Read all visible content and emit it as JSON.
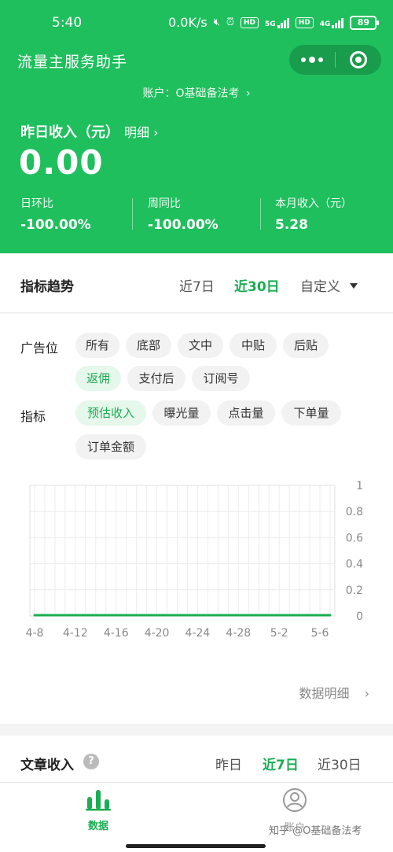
{
  "status_bar": {
    "time": "5:40",
    "net_speed": "0.0K/s",
    "hd1": "HD",
    "sig1": "5G",
    "hd2": "HD",
    "sig2": "4G",
    "battery": "89"
  },
  "header": {
    "app_title": "流量主服务助手",
    "account_label": "账户：O基础备法考",
    "account_chevron": "›",
    "yesterday_label": "昨日收入（元）",
    "detail_link": "明细 ›",
    "big_value": "0.00",
    "stats": [
      {
        "label": "日环比",
        "value": "-100.00%"
      },
      {
        "label": "周同比",
        "value": "-100.00%"
      },
      {
        "label": "本月收入（元）",
        "value": "5.28"
      }
    ]
  },
  "trend": {
    "title": "指标趋势",
    "range_tabs": [
      "近7日",
      "近30日",
      "自定义"
    ],
    "active_range": "近30日",
    "ad_position_label": "广告位",
    "ad_positions": [
      "所有",
      "底部",
      "文中",
      "中贴",
      "后贴",
      "返佣",
      "支付后",
      "订阅号"
    ],
    "metric_label": "指标",
    "metrics": [
      "预估收入",
      "曝光量",
      "点击量",
      "下单量",
      "订单金额"
    ],
    "data_detail": "数据明细",
    "data_detail_chevron": "›"
  },
  "chart_data": {
    "type": "line",
    "x_ticks": [
      "4-8",
      "4-12",
      "4-16",
      "4-20",
      "4-24",
      "4-28",
      "5-2",
      "5-6"
    ],
    "y_ticks": [
      "1",
      "0.8",
      "0.6",
      "0.4",
      "0.2",
      "0"
    ],
    "ylim": [
      0,
      1
    ],
    "grid": true,
    "series_color": "#1aad52",
    "values": [
      0,
      0,
      0,
      0,
      0,
      0,
      0,
      0,
      0,
      0,
      0,
      0,
      0,
      0,
      0,
      0,
      0,
      0,
      0,
      0,
      0,
      0,
      0,
      0,
      0,
      0,
      0,
      0,
      0,
      0
    ]
  },
  "article": {
    "title": "文章收入",
    "help_glyph": "?",
    "range_tabs": [
      "昨日",
      "近7日",
      "近30日"
    ],
    "active_range": "近7日"
  },
  "tabbar": {
    "items": [
      {
        "label": "数据",
        "icon": "bar-chart-icon"
      },
      {
        "label": "账户",
        "icon": "user-icon"
      }
    ]
  },
  "watermark_text": "知乎 @O基础备法考",
  "colors": {
    "brand": "#1fbf5d",
    "accent": "#1aad52"
  }
}
